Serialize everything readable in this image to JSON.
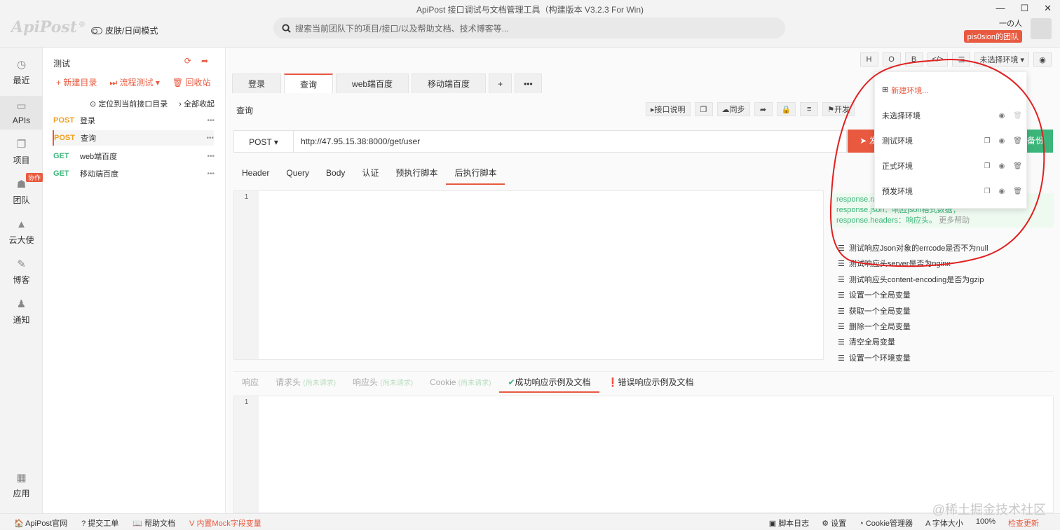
{
  "window": {
    "title": "ApiPost 接口调试与文档管理工具（构建版本 V3.2.3 For Win)",
    "logo": "ApiPost",
    "logo_mark": "®",
    "skin_toggle": "皮肤/日间模式",
    "search_placeholder": "搜索当前团队下的项目/接口/以及帮助文档、技术博客等...",
    "user_name": "一の人",
    "team_name": "pis0sion的团队"
  },
  "leftnav": {
    "items": [
      {
        "label": "最近",
        "icon": "clock-icon"
      },
      {
        "label": "APIs",
        "icon": "terminal-icon"
      },
      {
        "label": "项目",
        "icon": "project-icon"
      },
      {
        "label": "团队",
        "icon": "team-icon",
        "badge": "协作"
      },
      {
        "label": "云大使",
        "icon": "graduation-icon"
      },
      {
        "label": "博客",
        "icon": "edit-icon"
      },
      {
        "label": "通知",
        "icon": "bell-icon"
      },
      {
        "label": "应用",
        "icon": "apps-icon"
      }
    ]
  },
  "tree": {
    "title": "测试",
    "new_dir": "+ 新建目录",
    "flow_test": "流程测试",
    "recycle": "回收站",
    "locate": "定位到当前接口目录",
    "collapse": "全部收起",
    "apis": [
      {
        "method": "POST",
        "name": "登录",
        "color": "#f0a020"
      },
      {
        "method": "POST",
        "name": "查询",
        "color": "#f0a020"
      },
      {
        "method": "GET",
        "name": "web端百度",
        "color": "#3bb57a"
      },
      {
        "method": "GET",
        "name": "移动端百度",
        "color": "#3bb57a"
      }
    ]
  },
  "toolbar": {
    "h": "H",
    "o": "O",
    "b": "B",
    "code": "</>",
    "env_select": "未选择环境"
  },
  "tabs": [
    "登录",
    "查询",
    "web端百度",
    "移动端百度"
  ],
  "tab_add": "+",
  "tab_more": "•••",
  "api": {
    "name": "查询",
    "doc_btn": "接口说明",
    "sync_btn": "同步",
    "dev_btn": "开发",
    "method": "POST",
    "url": "http://47.95.15.38:8000/get/user",
    "send": "发",
    "save": "备份"
  },
  "subtabs": [
    "Header",
    "Query",
    "Body",
    "认证",
    "预执行脚本",
    "后执行脚本"
  ],
  "editor": {
    "line": "1"
  },
  "hint": {
    "line1": "response.raw",
    "line2": "response.json：响应json格式数据；",
    "line3": "response.headers：响应头。",
    "more": "更多帮助"
  },
  "snippets": [
    "测试响应Json对象的errcode是否不为null",
    "测试响应头server是否为nginx",
    "测试响应头content-encoding是否为gzip",
    "设置一个全局变量",
    "获取一个全局变量",
    "删除一个全局变量",
    "清空全局变量",
    "设置一个环境变量"
  ],
  "response_tabs": {
    "resp": "响应",
    "req_head": "请求头",
    "resp_head": "响应头",
    "cookie": "Cookie",
    "not_requested": "(尚未请求)",
    "success": "成功响应示例及文档",
    "error": "错误响应示例及文档"
  },
  "env_menu": {
    "new_env": "新建环境...",
    "envs": [
      "未选择环境",
      "测试环境",
      "正式环境",
      "预发环境"
    ]
  },
  "status": {
    "site": "ApiPost官网",
    "ticket": "提交工单",
    "help": "帮助文档",
    "mock": "内置Mock字段变量",
    "log": "脚本日志",
    "settings": "设置",
    "cookie_mgr": "Cookie管理器",
    "font_size": "字体大小",
    "zoom": "100%",
    "update": "检查更新"
  },
  "watermark": "@稀土掘金技术社区"
}
